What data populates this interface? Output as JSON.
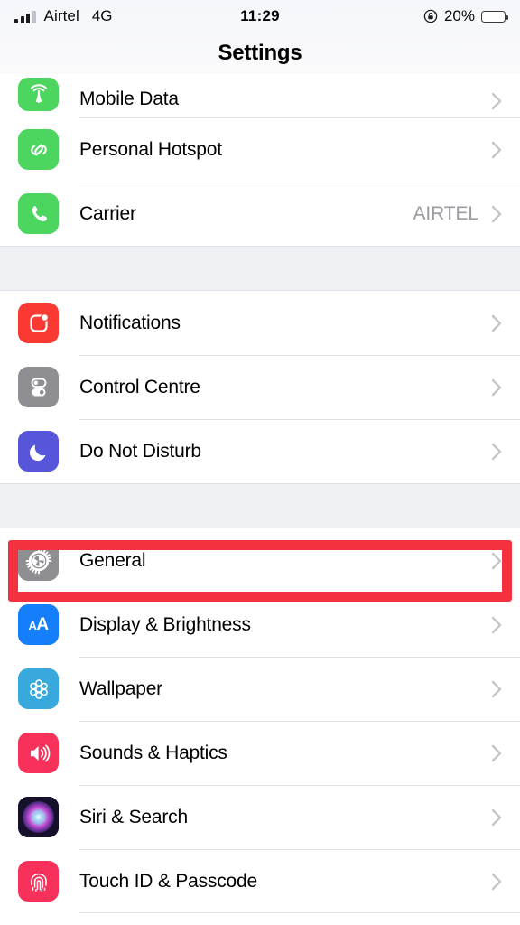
{
  "status_bar": {
    "carrier": "Airtel",
    "network": "4G",
    "time": "11:29",
    "battery_percent": "20%",
    "battery_level": 20,
    "battery_color": "#f0333c",
    "signal_bars": 3,
    "signal_bars_total": 4,
    "rotation_lock_icon": "rotation-lock-icon"
  },
  "nav": {
    "title": "Settings"
  },
  "sections": [
    {
      "name": "connectivity",
      "rows": [
        {
          "label": "Mobile Data",
          "value": "",
          "icon": "mobile-data-icon",
          "icon_color": "#4cd660",
          "clipped": true
        },
        {
          "label": "Personal Hotspot",
          "value": "",
          "icon": "personal-hotspot-icon",
          "icon_color": "#4cd660",
          "clipped": false
        },
        {
          "label": "Carrier",
          "value": "AIRTEL",
          "icon": "carrier-phone-icon",
          "icon_color": "#4cd660",
          "clipped": false
        }
      ]
    },
    {
      "name": "alerts",
      "rows": [
        {
          "label": "Notifications",
          "value": "",
          "icon": "notifications-icon",
          "icon_color": "#fa3a32",
          "clipped": false
        },
        {
          "label": "Control Centre",
          "value": "",
          "icon": "control-centre-icon",
          "icon_color": "#8e8e93",
          "clipped": false
        },
        {
          "label": "Do Not Disturb",
          "value": "",
          "icon": "do-not-disturb-moon-icon",
          "icon_color": "#5755d9",
          "clipped": false
        }
      ]
    },
    {
      "name": "system",
      "rows": [
        {
          "label": "General",
          "value": "",
          "icon": "general-gear-icon",
          "icon_color": "#8e8e93",
          "clipped": false,
          "highlighted": true
        },
        {
          "label": "Display & Brightness",
          "value": "",
          "icon": "display-brightness-icon",
          "icon_color": "#157efb",
          "clipped": false
        },
        {
          "label": "Wallpaper",
          "value": "",
          "icon": "wallpaper-icon",
          "icon_color": "#38a9dd",
          "clipped": false
        },
        {
          "label": "Sounds & Haptics",
          "value": "",
          "icon": "sounds-haptics-icon",
          "icon_color": "#f8315a",
          "clipped": false
        },
        {
          "label": "Siri & Search",
          "value": "",
          "icon": "siri-search-icon",
          "icon_color": "#121021",
          "clipped": false
        },
        {
          "label": "Touch ID & Passcode",
          "value": "",
          "icon": "touch-id-passcode-icon",
          "icon_color": "#f8315a",
          "clipped": false
        }
      ]
    }
  ],
  "annotation": {
    "type": "highlight-rectangle",
    "target": "General",
    "color": "#f4313f"
  }
}
